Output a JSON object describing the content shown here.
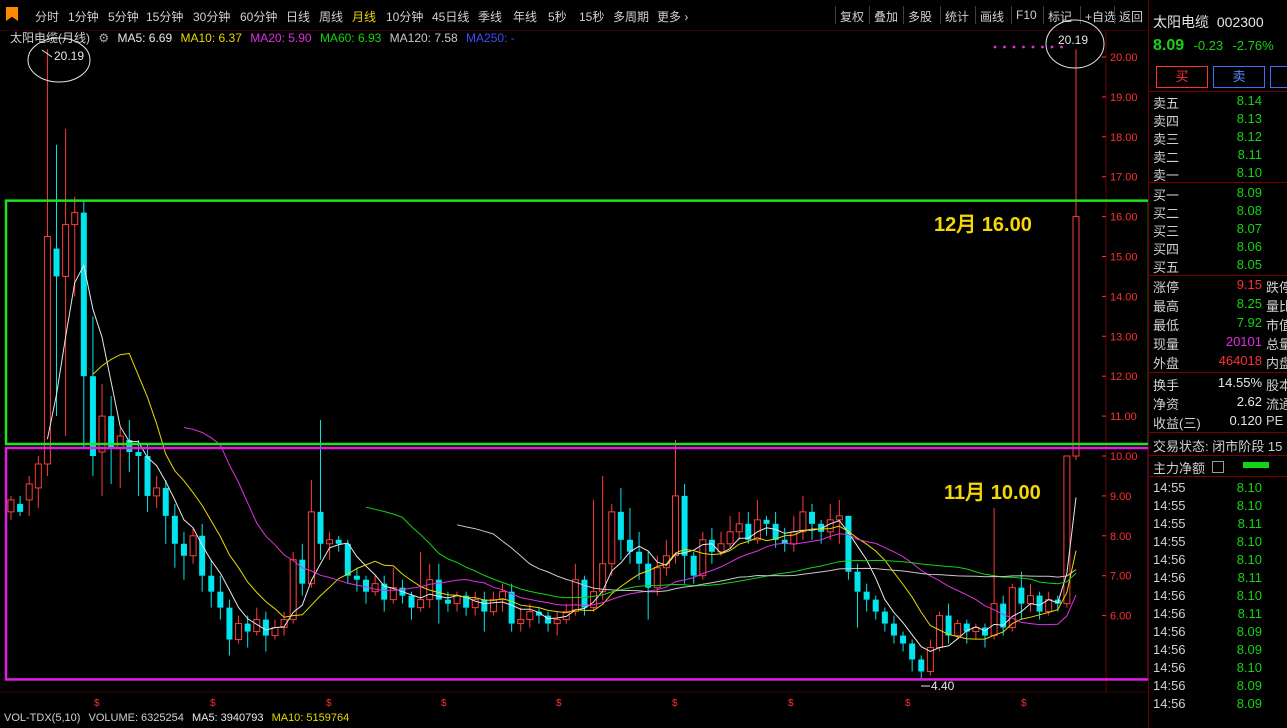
{
  "toolbar": {
    "tabs": [
      "分时",
      "1分钟",
      "5分钟",
      "15分钟",
      "30分钟",
      "60分钟",
      "日线",
      "周线",
      "月线",
      "10分钟",
      "45日线",
      "季线",
      "年线",
      "5秒",
      "15秒",
      "多周期",
      "更多 ›"
    ],
    "active_tab": "月线",
    "right_buttons": [
      "复权",
      "叠加",
      "多股",
      "统计",
      "画线",
      "F10",
      "标记",
      "+自选",
      "返回"
    ]
  },
  "legend": {
    "title": "太阳电缆(月线)",
    "ma5": "MA5: 6.69",
    "ma10": "MA10: 6.37",
    "ma20": "MA20: 5.90",
    "ma60": "MA60: 6.93",
    "ma120": "MA120: 7.58",
    "ma250": "MA250: -"
  },
  "chart_data": {
    "type": "candlestick",
    "price_axis_ticks": [
      "20.00",
      "19.00",
      "18.00",
      "17.00",
      "16.00",
      "15.00",
      "14.00",
      "13.00",
      "12.00",
      "11.00",
      "10.00",
      "9.00",
      "8.00",
      "7.00",
      "6.00"
    ],
    "ylim": [
      4.2,
      20.5
    ],
    "annotations": {
      "high_left": "20.19",
      "high_right": "20.19",
      "low": "4.40",
      "label_dec": "12月 16.00",
      "label_nov": "11月 10.00",
      "box_top": [
        10.3,
        16.4
      ],
      "box_bottom": [
        4.4,
        10.2
      ]
    },
    "candles": [
      [
        8.6,
        8.9,
        8.4,
        9.0
      ],
      [
        8.8,
        8.6,
        8.5,
        9.0
      ],
      [
        8.9,
        9.3,
        8.5,
        9.5
      ],
      [
        9.2,
        9.8,
        8.7,
        10.0
      ],
      [
        9.8,
        15.5,
        9.5,
        20.19
      ],
      [
        15.2,
        14.5,
        11.0,
        17.8
      ],
      [
        14.5,
        15.8,
        10.5,
        18.2
      ],
      [
        15.8,
        16.1,
        14.0,
        16.5
      ],
      [
        16.1,
        12.0,
        10.2,
        16.4
      ],
      [
        12.0,
        10.0,
        9.5,
        13.5
      ],
      [
        10.1,
        11.0,
        9.0,
        11.8
      ],
      [
        11.0,
        10.2,
        9.3,
        11.5
      ],
      [
        10.2,
        10.5,
        9.2,
        10.7
      ],
      [
        10.4,
        10.1,
        9.6,
        10.9
      ],
      [
        10.1,
        10.0,
        9.0,
        10.4
      ],
      [
        10.0,
        9.0,
        8.6,
        10.3
      ],
      [
        9.0,
        9.2,
        8.7,
        9.5
      ],
      [
        9.2,
        8.5,
        7.8,
        9.4
      ],
      [
        8.5,
        7.8,
        7.2,
        8.8
      ],
      [
        7.8,
        7.5,
        6.9,
        8.1
      ],
      [
        7.5,
        8.0,
        7.3,
        8.2
      ],
      [
        8.0,
        7.0,
        6.6,
        8.3
      ],
      [
        7.0,
        6.6,
        6.2,
        7.4
      ],
      [
        6.6,
        6.2,
        5.9,
        7.0
      ],
      [
        6.2,
        5.4,
        5.0,
        6.4
      ],
      [
        5.4,
        5.8,
        5.3,
        6.0
      ],
      [
        5.8,
        5.6,
        5.2,
        6.0
      ],
      [
        5.6,
        5.9,
        5.5,
        6.2
      ],
      [
        5.9,
        5.5,
        5.1,
        6.1
      ],
      [
        5.5,
        5.7,
        5.4,
        5.9
      ],
      [
        5.7,
        5.9,
        5.5,
        6.1
      ],
      [
        5.9,
        7.4,
        5.8,
        7.6
      ],
      [
        7.4,
        6.8,
        6.5,
        7.8
      ],
      [
        6.8,
        8.6,
        6.7,
        9.4
      ],
      [
        8.6,
        7.8,
        7.4,
        10.9
      ],
      [
        7.8,
        7.9,
        7.4,
        8.1
      ],
      [
        7.9,
        7.8,
        7.6,
        8.0
      ],
      [
        7.8,
        7.0,
        6.8,
        7.9
      ],
      [
        7.0,
        6.9,
        6.6,
        7.2
      ],
      [
        6.9,
        6.6,
        6.3,
        7.0
      ],
      [
        6.6,
        6.8,
        6.5,
        7.0
      ],
      [
        6.8,
        6.4,
        6.1,
        7.0
      ],
      [
        6.4,
        6.7,
        6.3,
        7.2
      ],
      [
        6.7,
        6.5,
        6.3,
        6.9
      ],
      [
        6.5,
        6.2,
        5.9,
        6.6
      ],
      [
        6.2,
        6.4,
        6.1,
        7.6
      ],
      [
        6.4,
        6.9,
        6.2,
        7.3
      ],
      [
        6.9,
        6.4,
        5.8,
        7.3
      ],
      [
        6.4,
        6.3,
        6.1,
        6.6
      ],
      [
        6.3,
        6.5,
        6.1,
        6.6
      ],
      [
        6.5,
        6.2,
        6.0,
        6.6
      ],
      [
        6.2,
        6.4,
        6.0,
        6.6
      ],
      [
        6.4,
        6.1,
        5.6,
        6.6
      ],
      [
        6.1,
        6.4,
        6.0,
        6.6
      ],
      [
        6.4,
        6.6,
        6.1,
        6.8
      ],
      [
        6.6,
        5.8,
        5.6,
        6.8
      ],
      [
        5.8,
        5.9,
        5.6,
        6.2
      ],
      [
        5.9,
        6.1,
        5.7,
        6.3
      ],
      [
        6.1,
        6.0,
        5.8,
        6.2
      ],
      [
        6.0,
        5.8,
        5.6,
        6.1
      ],
      [
        5.8,
        5.9,
        5.5,
        6.1
      ],
      [
        5.9,
        6.1,
        5.8,
        6.3
      ],
      [
        6.1,
        6.9,
        6.0,
        7.3
      ],
      [
        6.9,
        6.2,
        6.0,
        7.0
      ],
      [
        6.2,
        6.6,
        6.1,
        8.9
      ],
      [
        6.6,
        7.3,
        6.4,
        9.5
      ],
      [
        7.3,
        8.6,
        7.0,
        8.8
      ],
      [
        8.6,
        7.9,
        7.4,
        9.2
      ],
      [
        7.9,
        7.6,
        7.3,
        8.7
      ],
      [
        7.6,
        7.3,
        6.9,
        8.1
      ],
      [
        7.3,
        6.7,
        5.9,
        7.6
      ],
      [
        6.7,
        7.2,
        6.5,
        7.5
      ],
      [
        7.2,
        7.5,
        7.0,
        7.9
      ],
      [
        7.5,
        9.0,
        7.3,
        10.4
      ],
      [
        9.0,
        7.5,
        6.8,
        9.3
      ],
      [
        7.5,
        7.0,
        6.8,
        7.6
      ],
      [
        7.0,
        7.9,
        6.9,
        8.1
      ],
      [
        7.9,
        7.6,
        7.3,
        8.2
      ],
      [
        7.6,
        7.8,
        7.5,
        8.1
      ],
      [
        7.8,
        8.1,
        7.7,
        8.5
      ],
      [
        8.1,
        8.3,
        7.9,
        8.6
      ],
      [
        8.3,
        7.9,
        7.8,
        8.6
      ],
      [
        7.9,
        8.4,
        7.8,
        8.9
      ],
      [
        8.4,
        8.3,
        8.0,
        8.5
      ],
      [
        8.3,
        7.9,
        7.7,
        8.6
      ],
      [
        7.9,
        7.8,
        7.6,
        8.2
      ],
      [
        7.8,
        8.1,
        7.6,
        8.5
      ],
      [
        8.1,
        8.6,
        7.9,
        9.0
      ],
      [
        8.6,
        8.3,
        7.9,
        8.8
      ],
      [
        8.3,
        8.1,
        7.8,
        8.4
      ],
      [
        8.1,
        8.4,
        7.9,
        8.8
      ],
      [
        8.4,
        8.5,
        7.8,
        8.9
      ],
      [
        8.5,
        7.1,
        6.9,
        8.5
      ],
      [
        7.1,
        6.6,
        5.7,
        7.3
      ],
      [
        6.6,
        6.4,
        6.1,
        6.8
      ],
      [
        6.4,
        6.1,
        5.9,
        6.5
      ],
      [
        6.1,
        5.8,
        5.6,
        6.2
      ],
      [
        5.8,
        5.5,
        5.3,
        6.0
      ],
      [
        5.5,
        5.3,
        5.1,
        5.6
      ],
      [
        5.3,
        4.9,
        4.6,
        5.4
      ],
      [
        4.9,
        4.6,
        4.4,
        5.0
      ],
      [
        4.6,
        5.2,
        4.5,
        5.4
      ],
      [
        5.2,
        6.0,
        5.1,
        6.1
      ],
      [
        6.0,
        5.5,
        5.3,
        6.3
      ],
      [
        5.5,
        5.8,
        5.4,
        5.9
      ],
      [
        5.8,
        5.6,
        5.3,
        5.9
      ],
      [
        5.6,
        5.7,
        5.4,
        5.8
      ],
      [
        5.7,
        5.5,
        5.2,
        5.8
      ],
      [
        5.5,
        6.3,
        5.4,
        8.7
      ],
      [
        6.3,
        5.7,
        5.5,
        6.5
      ],
      [
        5.7,
        6.7,
        5.6,
        6.8
      ],
      [
        6.7,
        6.3,
        5.9,
        7.1
      ],
      [
        6.3,
        6.5,
        6.1,
        6.8
      ],
      [
        6.5,
        6.1,
        5.9,
        6.6
      ],
      [
        6.1,
        6.4,
        6.0,
        6.6
      ],
      [
        6.4,
        6.3,
        6.1,
        6.5
      ],
      [
        6.3,
        10.0,
        6.2,
        10.0
      ],
      [
        10.0,
        16.0,
        9.9,
        20.19
      ]
    ],
    "ma_lines": [
      {
        "name": "MA5",
        "color": "#e8e8e8"
      },
      {
        "name": "MA10",
        "color": "#e8d800"
      },
      {
        "name": "MA20",
        "color": "#e030e0"
      },
      {
        "name": "MA60",
        "color": "#14d314"
      },
      {
        "name": "MA120",
        "color": "#c8c8c8"
      }
    ]
  },
  "volume": {
    "label": "VOL-TDX(5,10)",
    "volume": "VOLUME: 6325254",
    "ma5": "MA5: 3940793",
    "ma10": "MA10: 5159764"
  },
  "quote": {
    "name": "太阳电缆",
    "code": "002300",
    "price": "8.09",
    "change": "-0.23",
    "change_pct": "-2.76%",
    "buy_label": "买",
    "sell_label": "卖",
    "asks": [
      [
        "卖五",
        "8.14"
      ],
      [
        "卖四",
        "8.13"
      ],
      [
        "卖三",
        "8.12"
      ],
      [
        "卖二",
        "8.11"
      ],
      [
        "卖一",
        "8.10"
      ]
    ],
    "bids": [
      [
        "买一",
        "8.09"
      ],
      [
        "买二",
        "8.08"
      ],
      [
        "买三",
        "8.07"
      ],
      [
        "买四",
        "8.06"
      ],
      [
        "买五",
        "8.05"
      ]
    ],
    "stats1": [
      [
        "涨停",
        "9.15",
        "跌停"
      ],
      [
        "最高",
        "8.25",
        "量比"
      ],
      [
        "最低",
        "7.92",
        "市值"
      ],
      [
        "现量",
        "20101",
        "总量"
      ],
      [
        "外盘",
        "464018",
        "内盘"
      ]
    ],
    "stats2": [
      [
        "换手",
        "14.55%",
        "股本"
      ],
      [
        "净资",
        "2.62",
        "流通"
      ],
      [
        "收益(三)",
        "0.120",
        "PE"
      ]
    ],
    "trade_status": "交易状态: 闭市阶段 15",
    "main_flow": "主力净额",
    "ticks": [
      [
        "14:55",
        "8.10"
      ],
      [
        "14:55",
        "8.10"
      ],
      [
        "14:55",
        "8.11"
      ],
      [
        "14:55",
        "8.10"
      ],
      [
        "14:56",
        "8.10"
      ],
      [
        "14:56",
        "8.11"
      ],
      [
        "14:56",
        "8.10"
      ],
      [
        "14:56",
        "8.11"
      ],
      [
        "14:56",
        "8.09"
      ],
      [
        "14:56",
        "8.09"
      ],
      [
        "14:56",
        "8.10"
      ],
      [
        "14:56",
        "8.09"
      ],
      [
        "14:56",
        "8.09"
      ]
    ]
  }
}
